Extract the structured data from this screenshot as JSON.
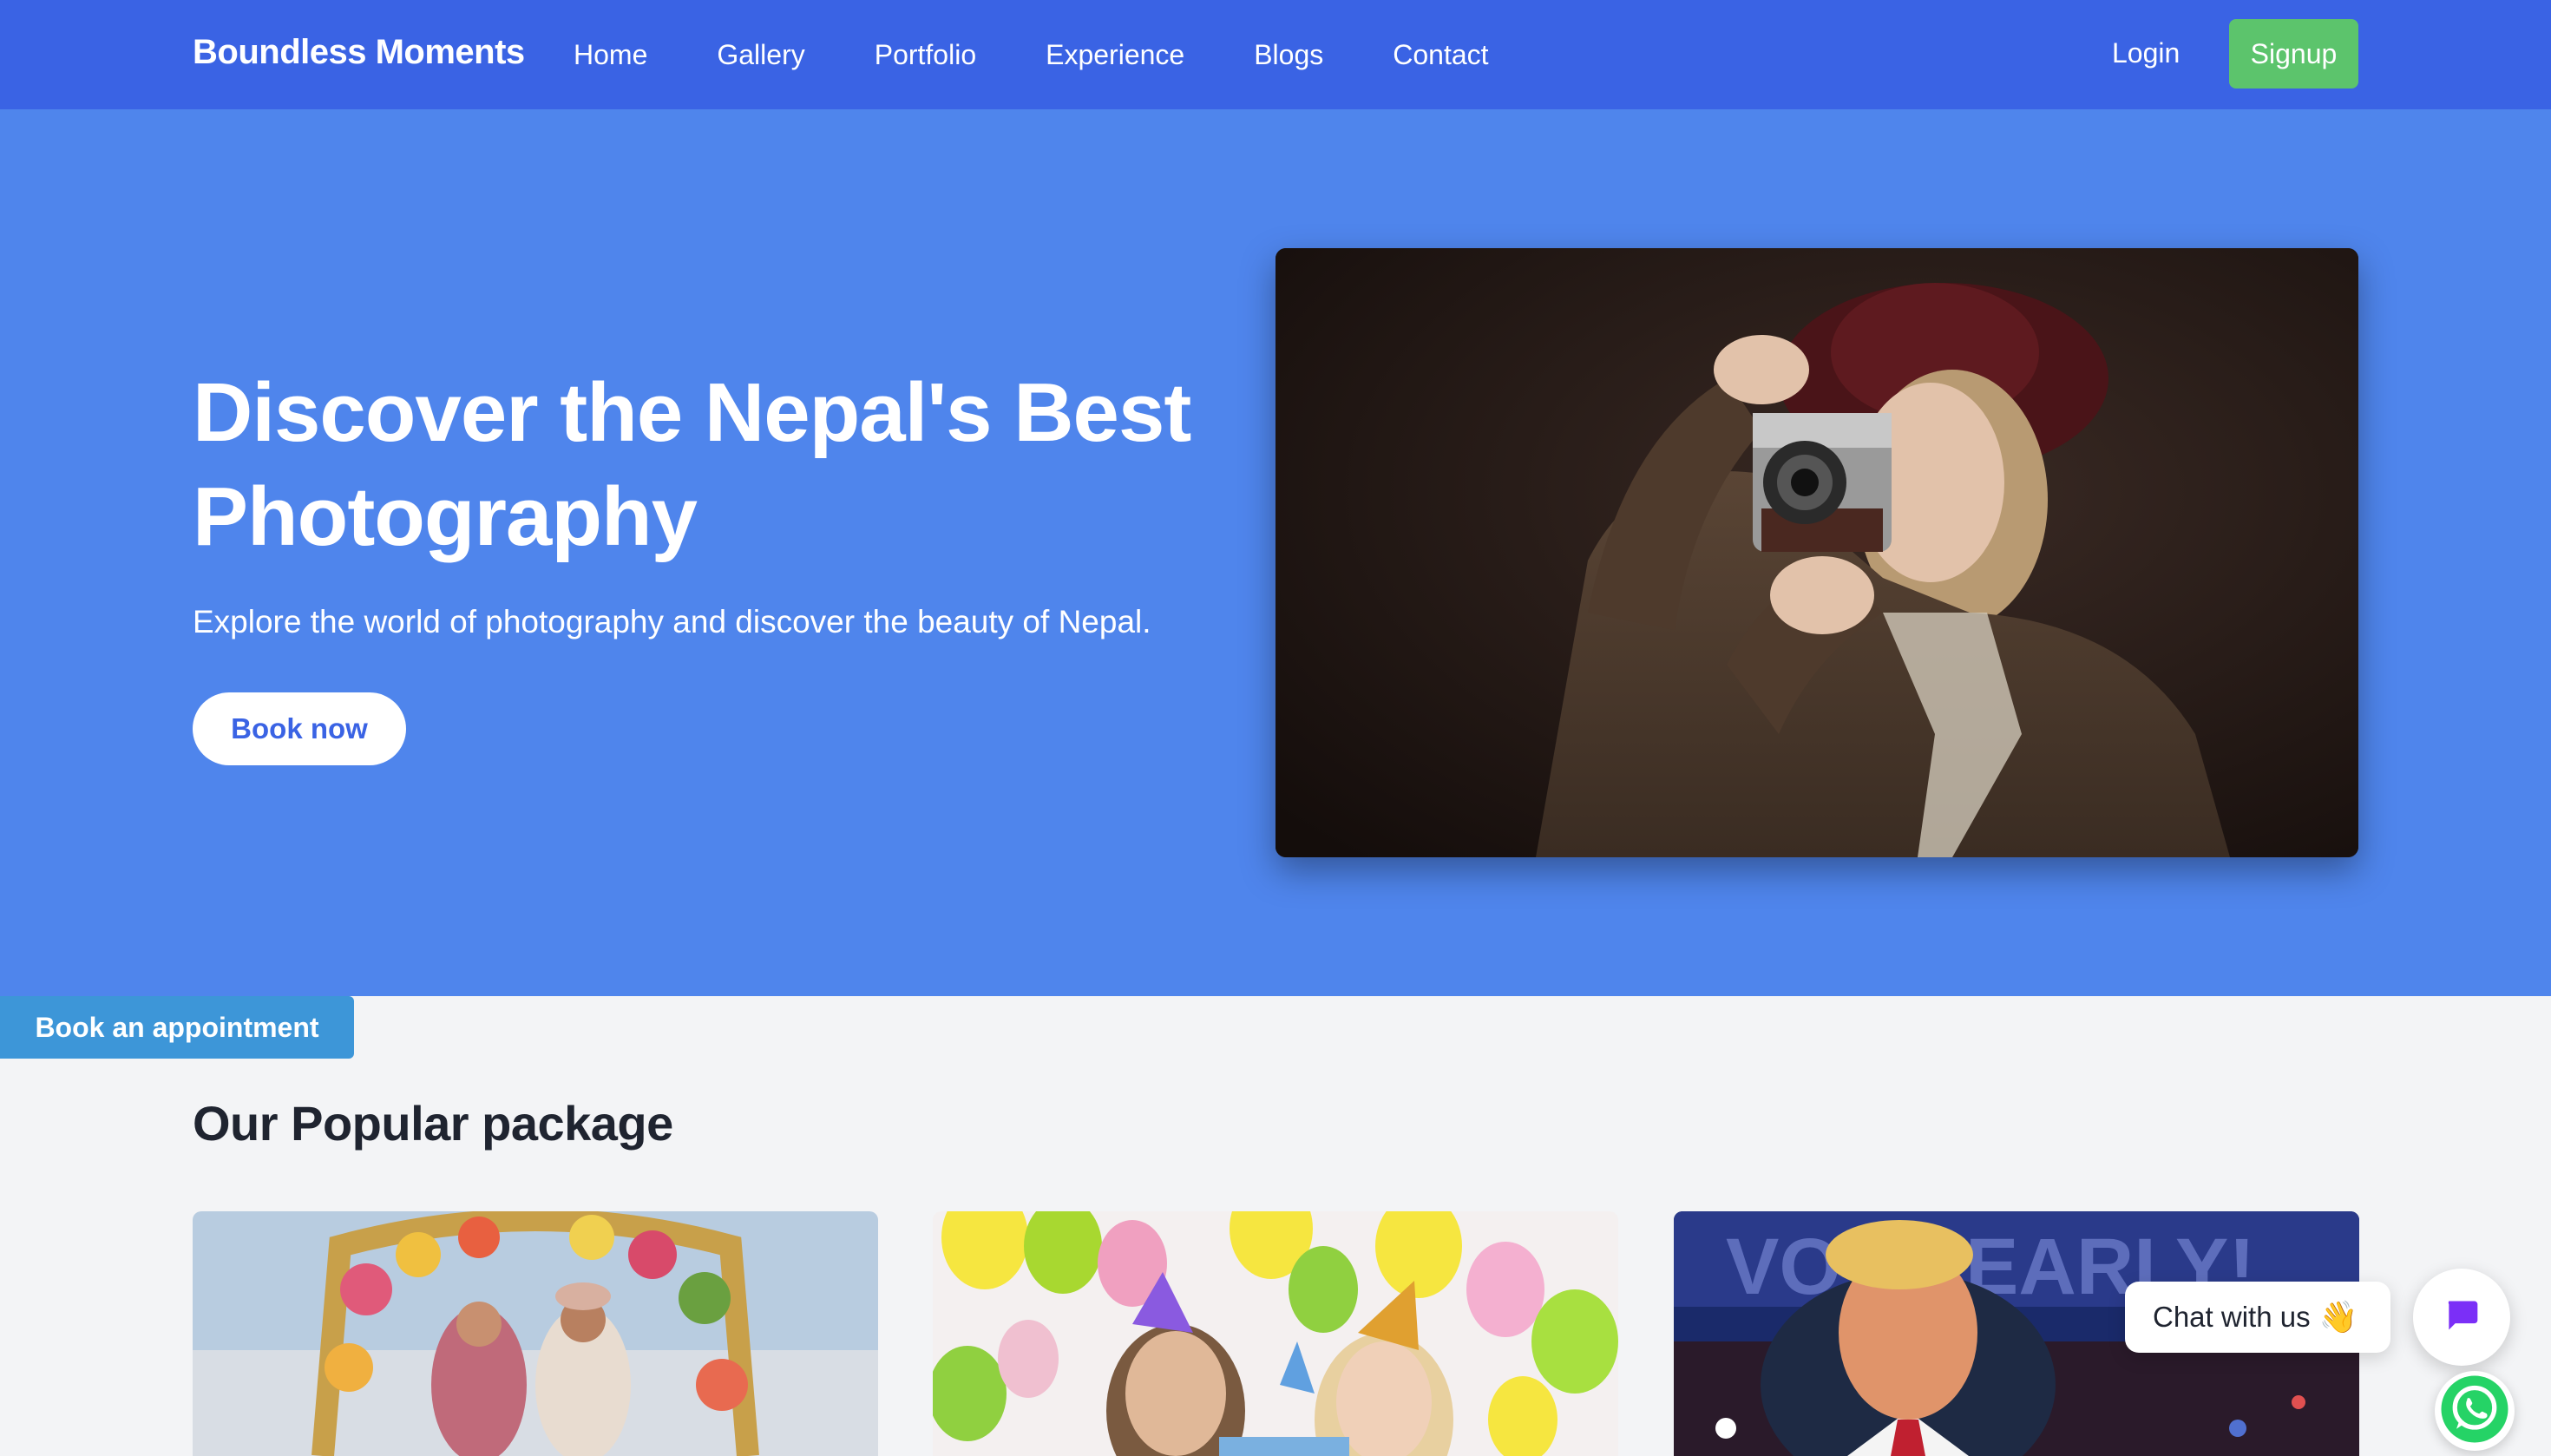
{
  "navbar": {
    "brand": "Boundless Moments",
    "links": [
      {
        "label": "Home"
      },
      {
        "label": "Gallery"
      },
      {
        "label": "Portfolio"
      },
      {
        "label": "Experience"
      },
      {
        "label": "Blogs"
      },
      {
        "label": "Contact"
      }
    ],
    "login_label": "Login",
    "signup_label": "Signup"
  },
  "hero": {
    "title": "Discover the Nepal's Best Photography",
    "subtitle": "Explore the world of photography and discover the beauty of Nepal.",
    "cta_label": "Book now"
  },
  "appointment_tab": {
    "label": "Book an appointment"
  },
  "packages": {
    "title": "Our Popular package"
  },
  "chat": {
    "bubble_text": "Chat with us",
    "wave_emoji": "👋"
  },
  "card3_sign": {
    "text": "VOTE EARLY!"
  },
  "colors": {
    "navbar_bg": "#3a63e4",
    "hero_bg": "#4f85ec",
    "signup_bg": "#5cc46c",
    "appointment_bg": "#3d96d8",
    "chat_icon": "#7b2ff7",
    "whatsapp": "#25d366"
  },
  "icons": {
    "chat": "chat-icon",
    "whatsapp": "whatsapp-icon"
  }
}
